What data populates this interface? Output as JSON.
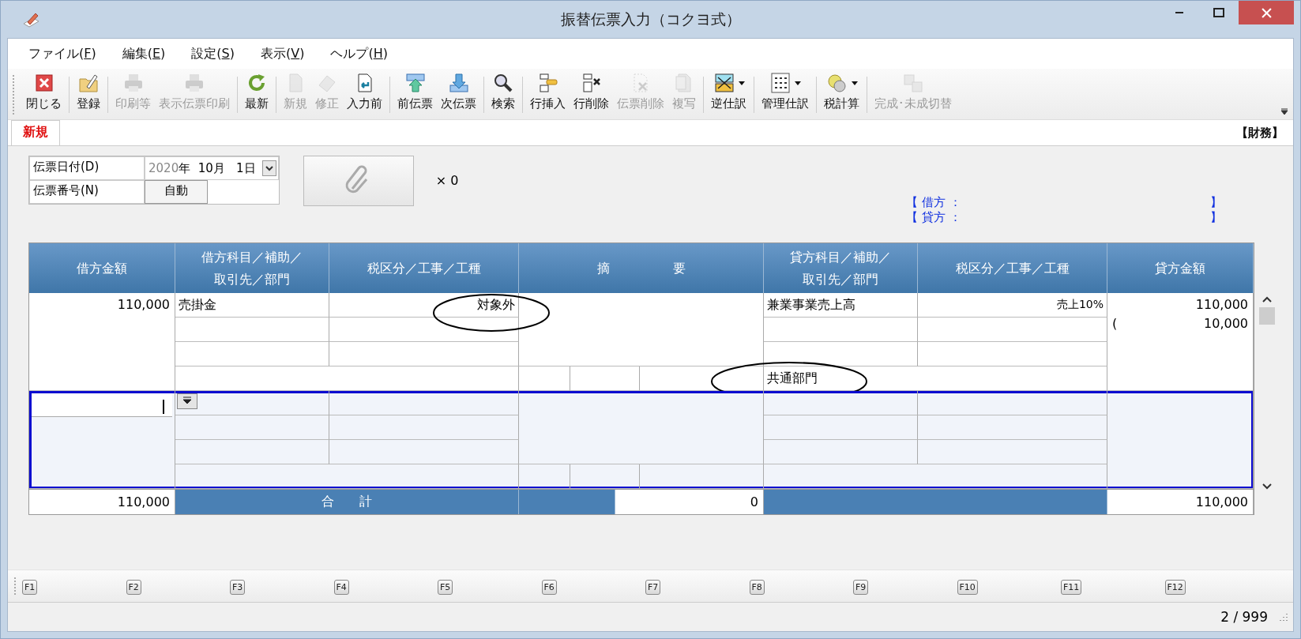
{
  "window": {
    "title": "振替伝票入力（コクヨ式）"
  },
  "menu": [
    "ファイル(F)",
    "編集(E)",
    "設定(S)",
    "表示(V)",
    "ヘルプ(H)"
  ],
  "toolbar": [
    {
      "label": "閉じる",
      "disabled": false,
      "dropdown": false
    },
    {
      "label": "登録",
      "disabled": false,
      "dropdown": false
    },
    {
      "label": "印刷等",
      "disabled": true,
      "dropdown": false
    },
    {
      "label": "表示伝票印刷",
      "disabled": true,
      "dropdown": false
    },
    {
      "label": "最新",
      "disabled": false,
      "dropdown": false
    },
    {
      "label": "新規",
      "disabled": true,
      "dropdown": false
    },
    {
      "label": "修正",
      "disabled": true,
      "dropdown": false
    },
    {
      "label": "入力前",
      "disabled": false,
      "dropdown": false
    },
    {
      "label": "前伝票",
      "disabled": false,
      "dropdown": false
    },
    {
      "label": "次伝票",
      "disabled": false,
      "dropdown": false
    },
    {
      "label": "検索",
      "disabled": false,
      "dropdown": false
    },
    {
      "label": "行挿入",
      "disabled": false,
      "dropdown": false
    },
    {
      "label": "行削除",
      "disabled": false,
      "dropdown": false
    },
    {
      "label": "伝票削除",
      "disabled": true,
      "dropdown": false
    },
    {
      "label": "複写",
      "disabled": true,
      "dropdown": false
    },
    {
      "label": "逆仕訳",
      "disabled": false,
      "dropdown": true
    },
    {
      "label": "管理仕訳",
      "disabled": false,
      "dropdown": true
    },
    {
      "label": "税計算",
      "disabled": false,
      "dropdown": true
    },
    {
      "label": "完成･未成切替",
      "disabled": true,
      "dropdown": false
    }
  ],
  "mode_tab": {
    "label": "新規",
    "selected": true
  },
  "department_tag": "【財務】",
  "form": {
    "date_label": "伝票日付(D)",
    "date_year": "2020",
    "date_rest": "年  10月   1日",
    "number_label": "伝票番号(N)",
    "number_value": "自動",
    "attachment_count": "× 0"
  },
  "balances": [
    {
      "label": "【  借方 ：",
      "close": "】"
    },
    {
      "label": "【  貸方 ：",
      "close": "】"
    }
  ],
  "table": {
    "columns": [
      "借方金額",
      "借方科目／補助／取引先／部門",
      "税区分／工事／工種",
      "摘　　　　　要",
      "貸方科目／補助／取引先／部門",
      "税区分／工事／工種",
      "貸方金額"
    ],
    "entries": [
      {
        "selected": false,
        "debit_amount": "110,000",
        "debit_account": "売掛金",
        "debit_tax": {
          "text": "対象外",
          "circled": true
        },
        "credit_account": "兼業事業売上高",
        "credit_tax": {
          "text": "売上10%",
          "circled": false
        },
        "department": {
          "text": "共通部門",
          "circled": true
        },
        "credit_amount": "110,000",
        "tax_open": "(",
        "tax_amount": "10,000"
      },
      {
        "selected": true
      }
    ],
    "totals": {
      "debit": "110,000",
      "label": "合　　計",
      "balance": "0",
      "credit": "110,000"
    }
  },
  "function_keys": [
    "F1",
    "F2",
    "F3",
    "F4",
    "F5",
    "F6",
    "F7",
    "F8",
    "F9",
    "F10",
    "F11",
    "F12"
  ],
  "status_bar": {
    "page": "2 / 999"
  }
}
